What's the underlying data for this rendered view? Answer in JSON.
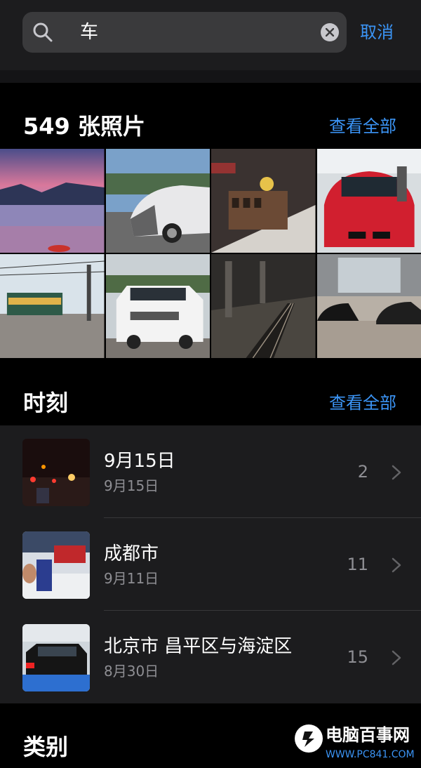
{
  "search": {
    "query": "车",
    "cancel_label": "取消"
  },
  "photos_section": {
    "title": "549 张照片",
    "see_all_label": "查看全部",
    "thumbnails": [
      {
        "desc": "lake sunset"
      },
      {
        "desc": "white car covered"
      },
      {
        "desc": "model train"
      },
      {
        "desc": "red bmw"
      },
      {
        "desc": "tram street"
      },
      {
        "desc": "white suv"
      },
      {
        "desc": "subway platform"
      },
      {
        "desc": "black sports cars"
      }
    ]
  },
  "moments_section": {
    "title": "时刻",
    "see_all_label": "查看全部",
    "items": [
      {
        "title": "9月15日",
        "date": "9月15日",
        "count": "2"
      },
      {
        "title": "成都市",
        "date": "9月11日",
        "count": "11"
      },
      {
        "title": "北京市 昌平区与海淀区",
        "date": "8月30日",
        "count": "15"
      }
    ]
  },
  "categories_section": {
    "title": "类别"
  },
  "watermark": {
    "brand": "电脑百事网",
    "url": "WWW.PC841.COM"
  },
  "colors": {
    "accent": "#3b94f5",
    "background": "#000000",
    "surface": "#1c1c1e",
    "secondary_text": "#8e8e93"
  }
}
